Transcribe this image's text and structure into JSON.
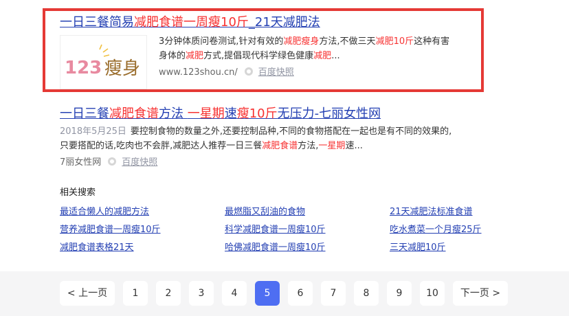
{
  "result1": {
    "title_parts": [
      "一日三餐简易",
      "减肥食谱",
      "一周",
      "瘦",
      "10斤",
      "_21天减肥法"
    ],
    "abstract_parts": [
      "3分钟体质问卷测试,针对有效的",
      "减肥瘦身",
      "方法,不做三天",
      "减肥10斤",
      "这种有害身体的",
      "减肥",
      "方式,提倡现代科学绿色健康",
      "减肥",
      "..."
    ],
    "thumb_text": "123瘦身",
    "source": "www.123shou.cn/",
    "snapshot_label": "百度快照"
  },
  "result2": {
    "title_parts": [
      "一日三餐",
      "减肥食谱",
      "方法 ",
      "一星期",
      "速",
      "瘦10斤",
      "无压力-七丽女性网"
    ],
    "date": "2018年5月25日",
    "abstract_parts": [
      "要控制食物的数量之外,还要控制品种,不同的食物搭配在一起也是有不同的效果的,只要搭配的话,吃肉也不会胖,减肥达人推荐一日三餐",
      "减肥食谱",
      "方法,",
      "一星期",
      "速..."
    ],
    "source": "7丽女性网",
    "snapshot_label": "百度快照"
  },
  "related": {
    "title": "相关搜索",
    "items": [
      "最适合懒人的减肥方法",
      "最燃脂又刮油的食物",
      "21天减肥法标准食谱",
      "营养减肥食谱一周瘦10斤",
      "科学减肥食谱一周瘦10斤",
      "吃水煮菜一个月瘦25斤",
      "减肥食谱表格21天",
      "哈佛减肥食谱一周瘦10斤",
      "三天减肥10斤"
    ]
  },
  "pagination": {
    "prev": "< 上一页",
    "pages": [
      "1",
      "2",
      "3",
      "4",
      "5",
      "6",
      "7",
      "8",
      "9",
      "10"
    ],
    "current": "5",
    "next": "下一页 >"
  },
  "colors": {
    "link": "#2440b3",
    "highlight": "#f73131",
    "frame": "#e53935",
    "active_page": "#4e6ef2"
  }
}
